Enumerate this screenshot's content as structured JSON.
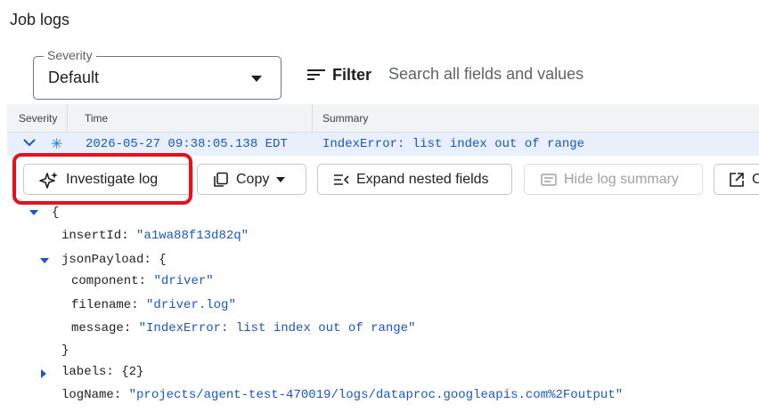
{
  "header": {
    "title": "Job logs"
  },
  "severity": {
    "legend": "Severity",
    "value": "Default"
  },
  "filter": {
    "label": "Filter",
    "placeholder": "Search all fields and values"
  },
  "table": {
    "columns": [
      "Severity",
      "Time",
      "Summary"
    ]
  },
  "log_entry": {
    "severity_icon": "asterisk-icon",
    "time": "2026-05-27 09:38:05.138 EDT",
    "summary": "IndexError: list index out of range"
  },
  "actions": {
    "investigate": "Investigate log",
    "copy": "Copy",
    "expand": "Expand nested fields",
    "hide_summary": "Hide log summary",
    "open_partial": "C"
  },
  "payload": {
    "open_brace": "{",
    "insertId_key": "insertId",
    "insertId_value": "\"a1wa88f13d82q\"",
    "jsonPayload_key": "jsonPayload",
    "jsonPayload_open": "{",
    "component_key": "component",
    "component_value": "\"driver\"",
    "filename_key": "filename",
    "filename_value": "\"driver.log\"",
    "message_key": "message",
    "message_value": "\"IndexError: list index out of range\"",
    "jsonPayload_close": "}",
    "labels_key": "labels",
    "labels_value": "{2}",
    "logName_key": "logName",
    "logName_value": "\"projects/agent-test-470019/logs/dataproc.googleapis.com%2Foutput\""
  },
  "colors": {
    "accent": "#1a73e8",
    "selected_row": "#e8f0fe",
    "highlight": "#e8101c",
    "string_value": "#1a56c6"
  }
}
